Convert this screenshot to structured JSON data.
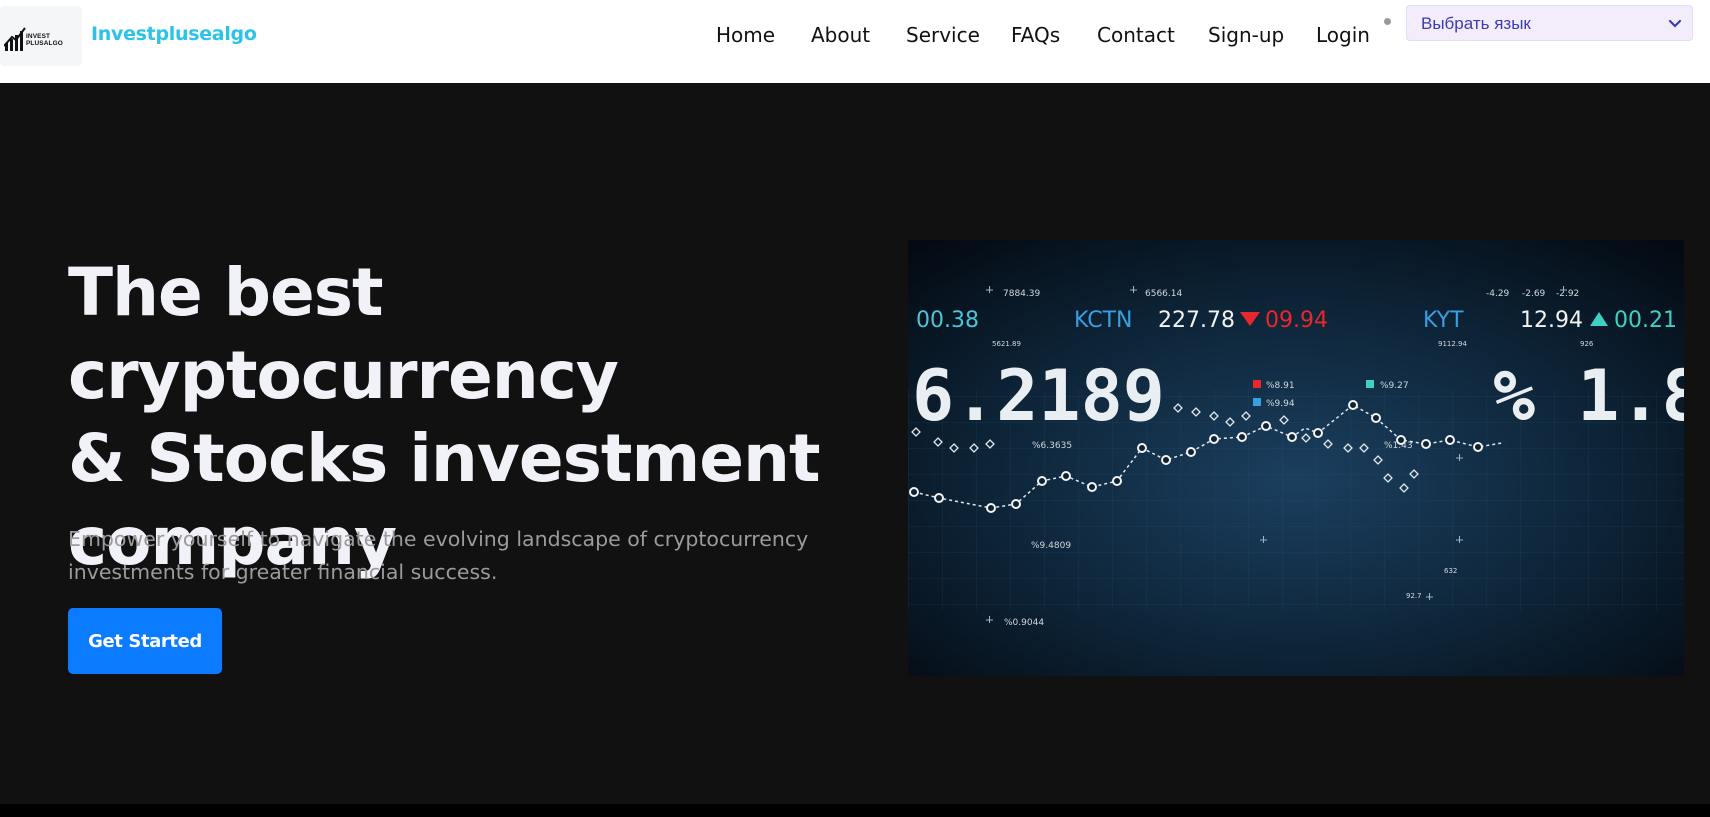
{
  "header": {
    "logo_text": [
      "INVEST",
      "PLUSALGO"
    ],
    "brand": "Investplusealgo",
    "nav": [
      "Home",
      "About",
      "Service",
      "FAQs",
      "Contact",
      "Sign-up",
      "Login"
    ],
    "language_select": {
      "value": "Выбрать язык"
    }
  },
  "hero": {
    "title_lines": [
      "The best cryptocurrency",
      "& Stocks investment",
      "company"
    ],
    "subtitle_lines": [
      "Empower yourself to navigate the evolving landscape of cryptocurrency",
      "investments for greater financial success."
    ],
    "cta_label": "Get Started",
    "image": {
      "ticker": {
        "left_value": "00.38",
        "symbol_1": "KCTN",
        "price_1": "227.78",
        "change_1": "09.94",
        "symbol_2": "KYT",
        "price_2": "12.94",
        "change_2": "00.21"
      },
      "big_left": "6.2189",
      "big_right": "% 1.8",
      "small_labels": [
        "7884.39",
        "6566.14",
        "-4.29",
        "-2.69",
        "-2.92",
        "%8.91",
        "%9.27",
        "%9.94",
        "%6.3635",
        "%1.43",
        "%9.4809",
        "%0.9044",
        "5621.89",
        "9112.94",
        "926",
        "632",
        "92.7"
      ],
      "colors": {
        "cyan": "#4ec3d6",
        "blue": "#3a9ee0",
        "red": "#e8282d",
        "teal": "#3fd0c4",
        "white": "#f2f2f2"
      }
    }
  },
  "colors": {
    "nav_bg": "#ffffff",
    "hero_bg": "#111111",
    "brand": "#2bc4e8",
    "title": "#f1f1f8",
    "subtitle": "#9b9b9b",
    "cta": "#0b7bff"
  }
}
